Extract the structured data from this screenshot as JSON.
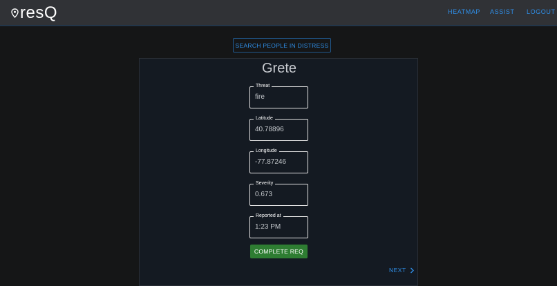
{
  "app": {
    "brand": "resQ"
  },
  "nav": {
    "heatmap": "HEATMAP",
    "assist": "ASSIST",
    "logout": "LOGOUT"
  },
  "search_button": "SEARCH PEOPLE IN DISTRESS",
  "card": {
    "name": "Grete",
    "fields": [
      {
        "label": "Threat",
        "value": "fire"
      },
      {
        "label": "Latitude",
        "value": "40.78896"
      },
      {
        "label": "Longitude",
        "value": "-77.87246"
      },
      {
        "label": "Severity",
        "value": "0.673"
      },
      {
        "label": "Reported at",
        "value": "1:23 PM"
      }
    ],
    "complete_button": "COMPLETE REQ",
    "next_button": "NEXT"
  },
  "icons": {
    "brand": "location-pin-icon",
    "next": "chevron-right-icon"
  },
  "colors": {
    "accent": "#2f8fe8",
    "complete": "#2e7d32",
    "header": "#303236"
  }
}
